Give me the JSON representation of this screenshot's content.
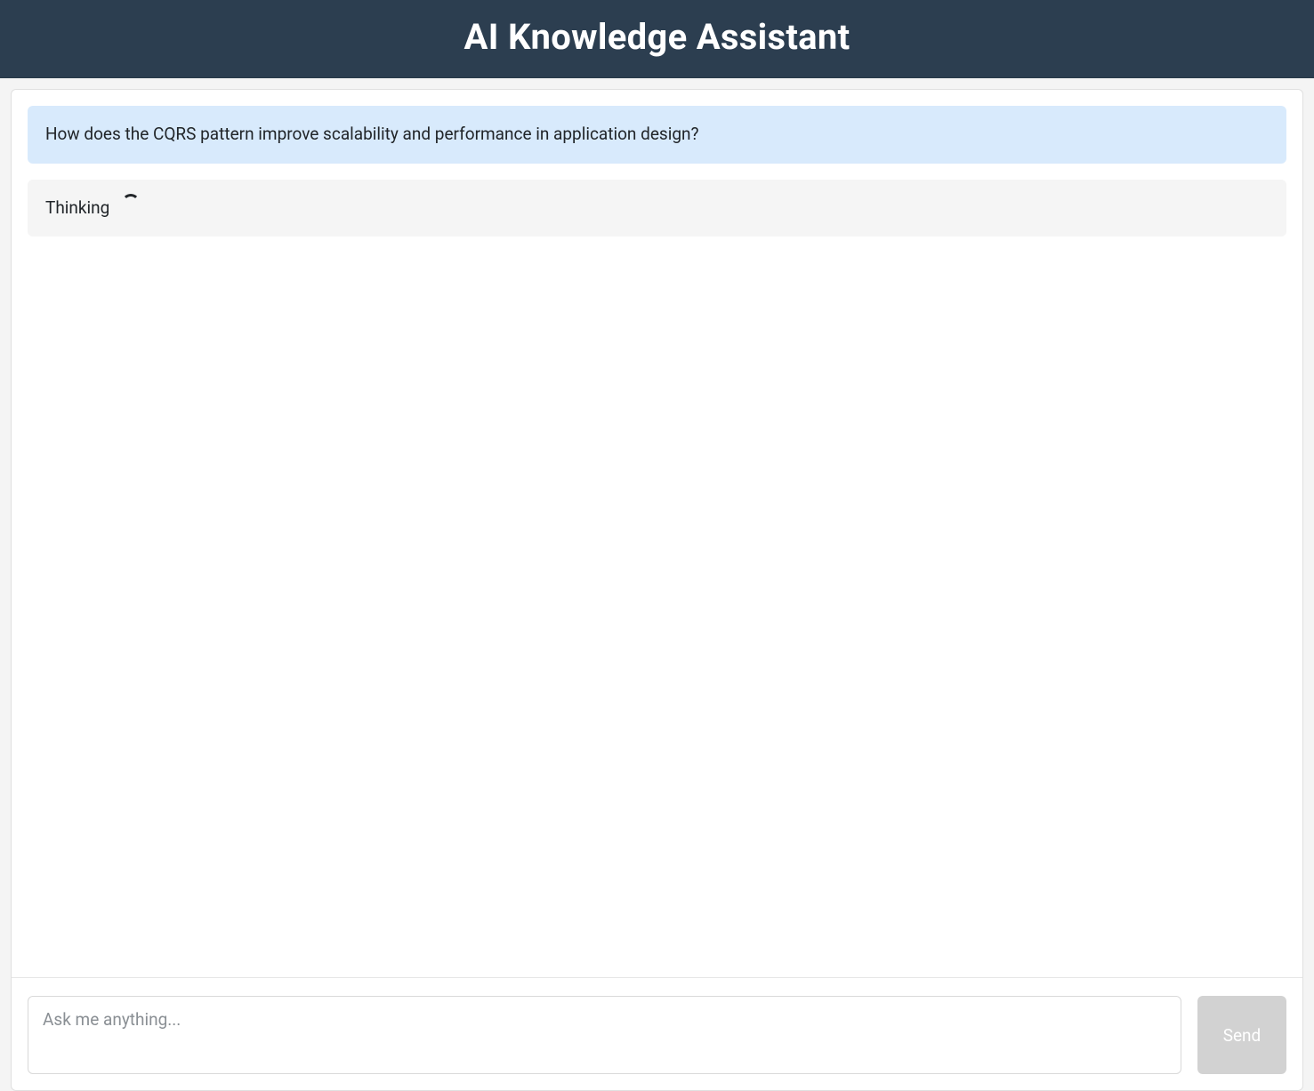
{
  "header": {
    "title": "AI Knowledge Assistant"
  },
  "messages": [
    {
      "role": "user",
      "text": "How does the CQRS pattern improve scalability and performance in application design?"
    },
    {
      "role": "assistant",
      "text": "Thinking",
      "loading": true
    }
  ],
  "composer": {
    "placeholder": "Ask me anything...",
    "value": "",
    "send_label": "Send",
    "send_disabled": true
  }
}
